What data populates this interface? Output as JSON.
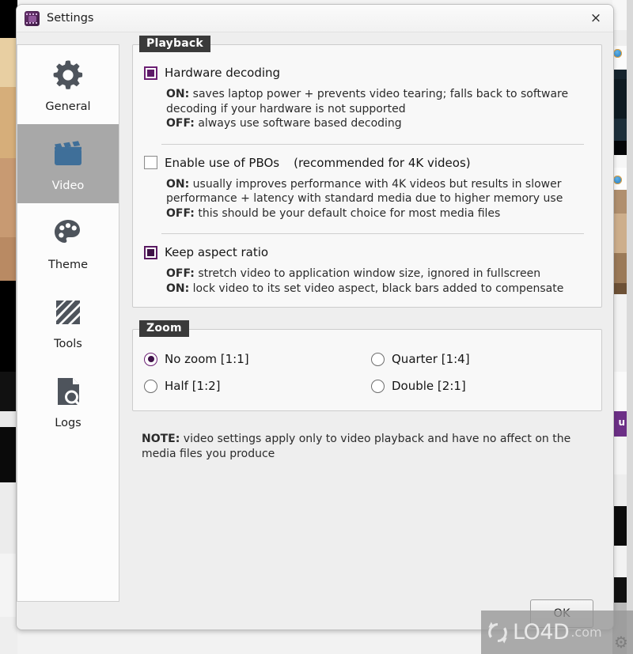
{
  "window": {
    "title": "Settings",
    "app_icon": "film-strip-icon",
    "close_label": "×"
  },
  "sidebar": {
    "items": [
      {
        "label": "General",
        "icon": "gear-icon",
        "active": false
      },
      {
        "label": "Video",
        "icon": "clapperboard-icon",
        "active": true
      },
      {
        "label": "Theme",
        "icon": "palette-icon",
        "active": false
      },
      {
        "label": "Tools",
        "icon": "tools-icon",
        "active": false
      },
      {
        "label": "Logs",
        "icon": "document-search-icon",
        "active": false
      }
    ]
  },
  "playback": {
    "legend": "Playback",
    "options": [
      {
        "label": "Hardware decoding",
        "checked": true,
        "lines": [
          {
            "tag": "ON:",
            "text": " saves laptop power + prevents video tearing; falls back to software decoding if your hardware is not supported"
          },
          {
            "tag": "OFF:",
            "text": " always use software based decoding"
          }
        ]
      },
      {
        "label": "Enable use of PBOs",
        "hint": "(recommended for 4K videos)",
        "checked": false,
        "lines": [
          {
            "tag": "ON:",
            "text": " usually improves performance with 4K videos but results in slower performance + latency with standard media due to higher memory use"
          },
          {
            "tag": "OFF:",
            "text": " this should be your default choice for most media files"
          }
        ]
      },
      {
        "label": "Keep aspect ratio",
        "checked": true,
        "lines": [
          {
            "tag": "OFF:",
            "text": " stretch video to application window size, ignored in fullscreen"
          },
          {
            "tag": "ON:",
            "text": " lock video to its set video aspect, black bars added to compensate"
          }
        ]
      }
    ]
  },
  "zoom": {
    "legend": "Zoom",
    "options": [
      {
        "label": "No zoom [1:1]",
        "selected": true
      },
      {
        "label": "Quarter [1:4]",
        "selected": false
      },
      {
        "label": "Half [1:2]",
        "selected": false
      },
      {
        "label": "Double [2:1]",
        "selected": false
      }
    ]
  },
  "note": {
    "tag": "NOTE:",
    "text": " video settings apply only to video playback and have no affect on the media files you produce"
  },
  "footer": {
    "ok_label": "OK"
  },
  "watermark": {
    "text": "LO4D",
    "suffix": ".com"
  },
  "colors": {
    "accent_purple": "#5d1a68",
    "legend_bg": "#3a3a3a",
    "active_nav_bg": "#a8a8a8",
    "video_icon_blue": "#3f6f99",
    "icon_gray": "#4e545c"
  }
}
